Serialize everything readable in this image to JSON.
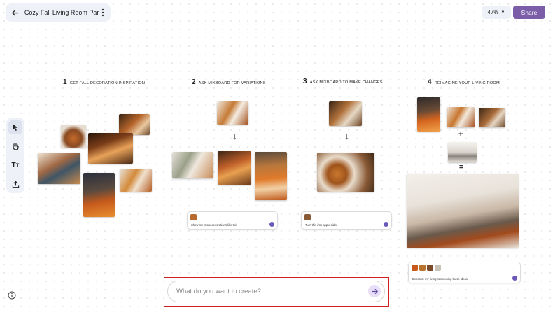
{
  "header": {
    "title": "Cozy Fall Living Room Par...",
    "zoom": "47%",
    "share_label": "Share"
  },
  "steps": [
    {
      "num": "1",
      "label": "GET FALL DECORATION INSPIRATION"
    },
    {
      "num": "2",
      "label": "ASK MIXBOARD FOR VARIATIONS"
    },
    {
      "num": "3",
      "label": "ASK MIXBOARD TO MAKE CHANGES"
    },
    {
      "num": "4",
      "label": "REIMAGINE YOUR LIVING ROOM"
    }
  ],
  "cards": {
    "step2": "Show me more decorations like this",
    "step3": "Turn this into apple cider",
    "step4": "Decorate my living room using these ideas"
  },
  "symbols": {
    "down_arrow": "↓",
    "plus": "+",
    "equals": "="
  },
  "prompt": {
    "placeholder": "What do you want to create?"
  },
  "colors": {
    "accent": "#7b5ea7",
    "highlight": "#d0201e"
  }
}
